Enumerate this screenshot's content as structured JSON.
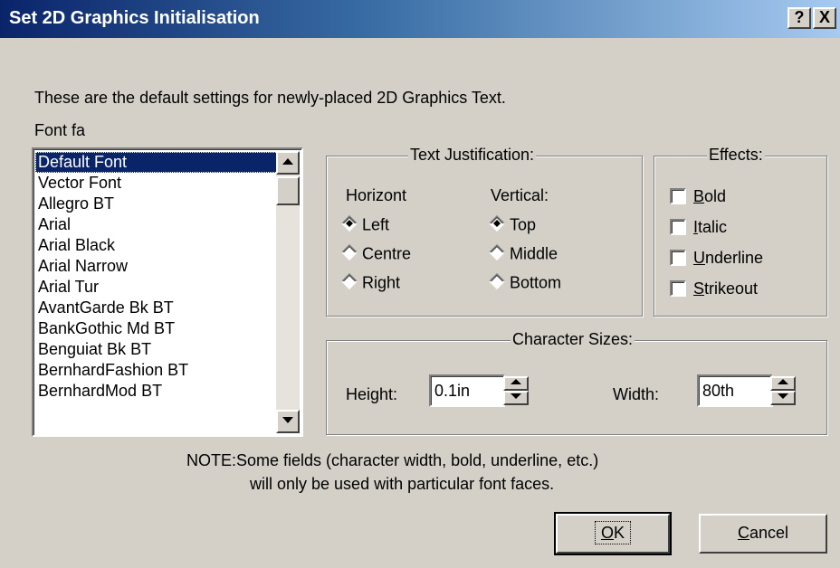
{
  "window": {
    "title": "Set 2D Graphics Initialisation",
    "help_button": "?",
    "close_button": "X"
  },
  "intro_text": "These are the default settings for newly-placed 2D Graphics Text.",
  "font_face_label": "Font fa",
  "font_list": {
    "selected": "Default Font",
    "items": [
      "Default Font",
      "Vector Font",
      "Allegro BT",
      "Arial",
      "Arial Black",
      "Arial Narrow",
      "Arial Tur",
      "AvantGarde Bk BT",
      "BankGothic Md BT",
      "Benguiat Bk BT",
      "BernhardFashion BT",
      "BernhardMod BT"
    ]
  },
  "justification": {
    "title": "Text Justification:",
    "horizontal_label": "Horizont",
    "vertical_label": "Vertical:",
    "horizontal_options": [
      "Left",
      "Centre",
      "Right"
    ],
    "vertical_options": [
      "Top",
      "Middle",
      "Bottom"
    ],
    "horizontal_selected": "Left",
    "vertical_selected": "Top"
  },
  "effects": {
    "title": "Effects:",
    "options": [
      {
        "label": "Bold",
        "accel": "B",
        "rest": "old",
        "checked": false
      },
      {
        "label": "Italic",
        "accel": "I",
        "rest": "talic",
        "checked": false
      },
      {
        "label": "Underline",
        "accel": "U",
        "rest": "nderline",
        "checked": false
      },
      {
        "label": "Strikeout",
        "accel": "S",
        "rest": "trikeout",
        "checked": false
      }
    ]
  },
  "char_sizes": {
    "title": "Character Sizes:",
    "height_label": "Height:",
    "height_value": "0.1in",
    "width_label": "Width:",
    "width_value": "80th"
  },
  "note": {
    "line1": "NOTE:Some fields (character width, bold, underline, etc.)",
    "line2": "will only be used with particular font faces."
  },
  "buttons": {
    "ok": {
      "accel": "O",
      "rest": "K"
    },
    "cancel": {
      "accel": "C",
      "rest": "ancel"
    }
  },
  "colors": {
    "dialog_bg": "#d4d0c8",
    "title_start": "#0a246a",
    "title_end": "#a6caf0",
    "selection": "#0a246a"
  }
}
